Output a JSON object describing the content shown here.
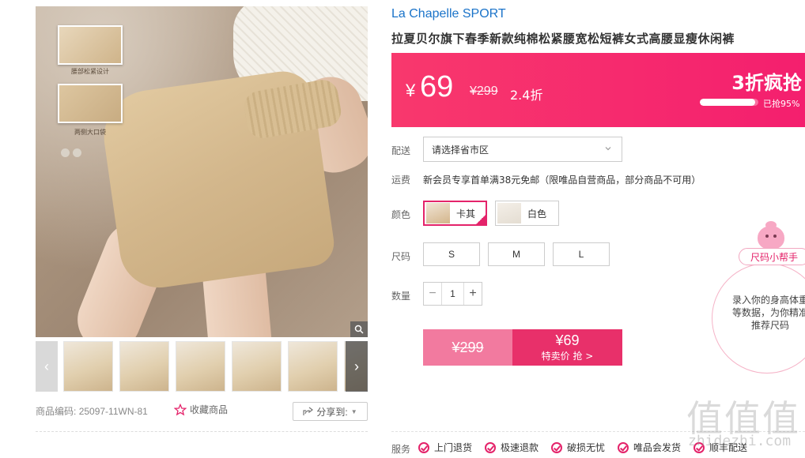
{
  "gallery": {
    "captions": [
      "腰部松紧设计",
      "两侧大口袋"
    ],
    "thumb_count": 5
  },
  "product": {
    "code_label": "商品编码:",
    "code": "25097-11WN-81",
    "favorite_label": "收藏商品",
    "share_label": "分享到:"
  },
  "brand": "La Chapelle SPORT",
  "title": "拉夏贝尔旗下春季新款纯棉松紧腰宽松短裤女式高腰显瘦休闲裤",
  "price_bar": {
    "currency": "¥",
    "price": "69",
    "original": "¥299",
    "discount": "2.4折",
    "promo": "3折疯抢",
    "sold_text": "已抢95%",
    "sold_fraction": 0.95
  },
  "shipping": {
    "label": "配送",
    "placeholder": "请选择省市区"
  },
  "fee": {
    "label": "运费",
    "text": "新会员专享首单满38元免邮（限唯品自营商品，部分商品不可用）"
  },
  "color": {
    "label": "颜色",
    "options": [
      "卡其",
      "白色"
    ],
    "selected": "卡其"
  },
  "size": {
    "label": "尺码",
    "options": [
      "S",
      "M",
      "L"
    ]
  },
  "quantity": {
    "label": "数量",
    "value": "1"
  },
  "buy": {
    "original": "¥299",
    "price": "¥69",
    "label": "特卖价 抢 >"
  },
  "size_helper": {
    "tag": "尺码小帮手",
    "text": "录入你的身高体重等数据，为你精准推荐尺码"
  },
  "services": {
    "label": "服务",
    "items": [
      "上门退货",
      "极速退款",
      "破损无忧",
      "唯品会发货",
      "顺丰配送"
    ]
  },
  "watermark": {
    "main": "值值值",
    "sub": "zhidezhi.com"
  },
  "colors": {
    "accent": "#e4236a",
    "brand_link": "#1a73c9"
  }
}
